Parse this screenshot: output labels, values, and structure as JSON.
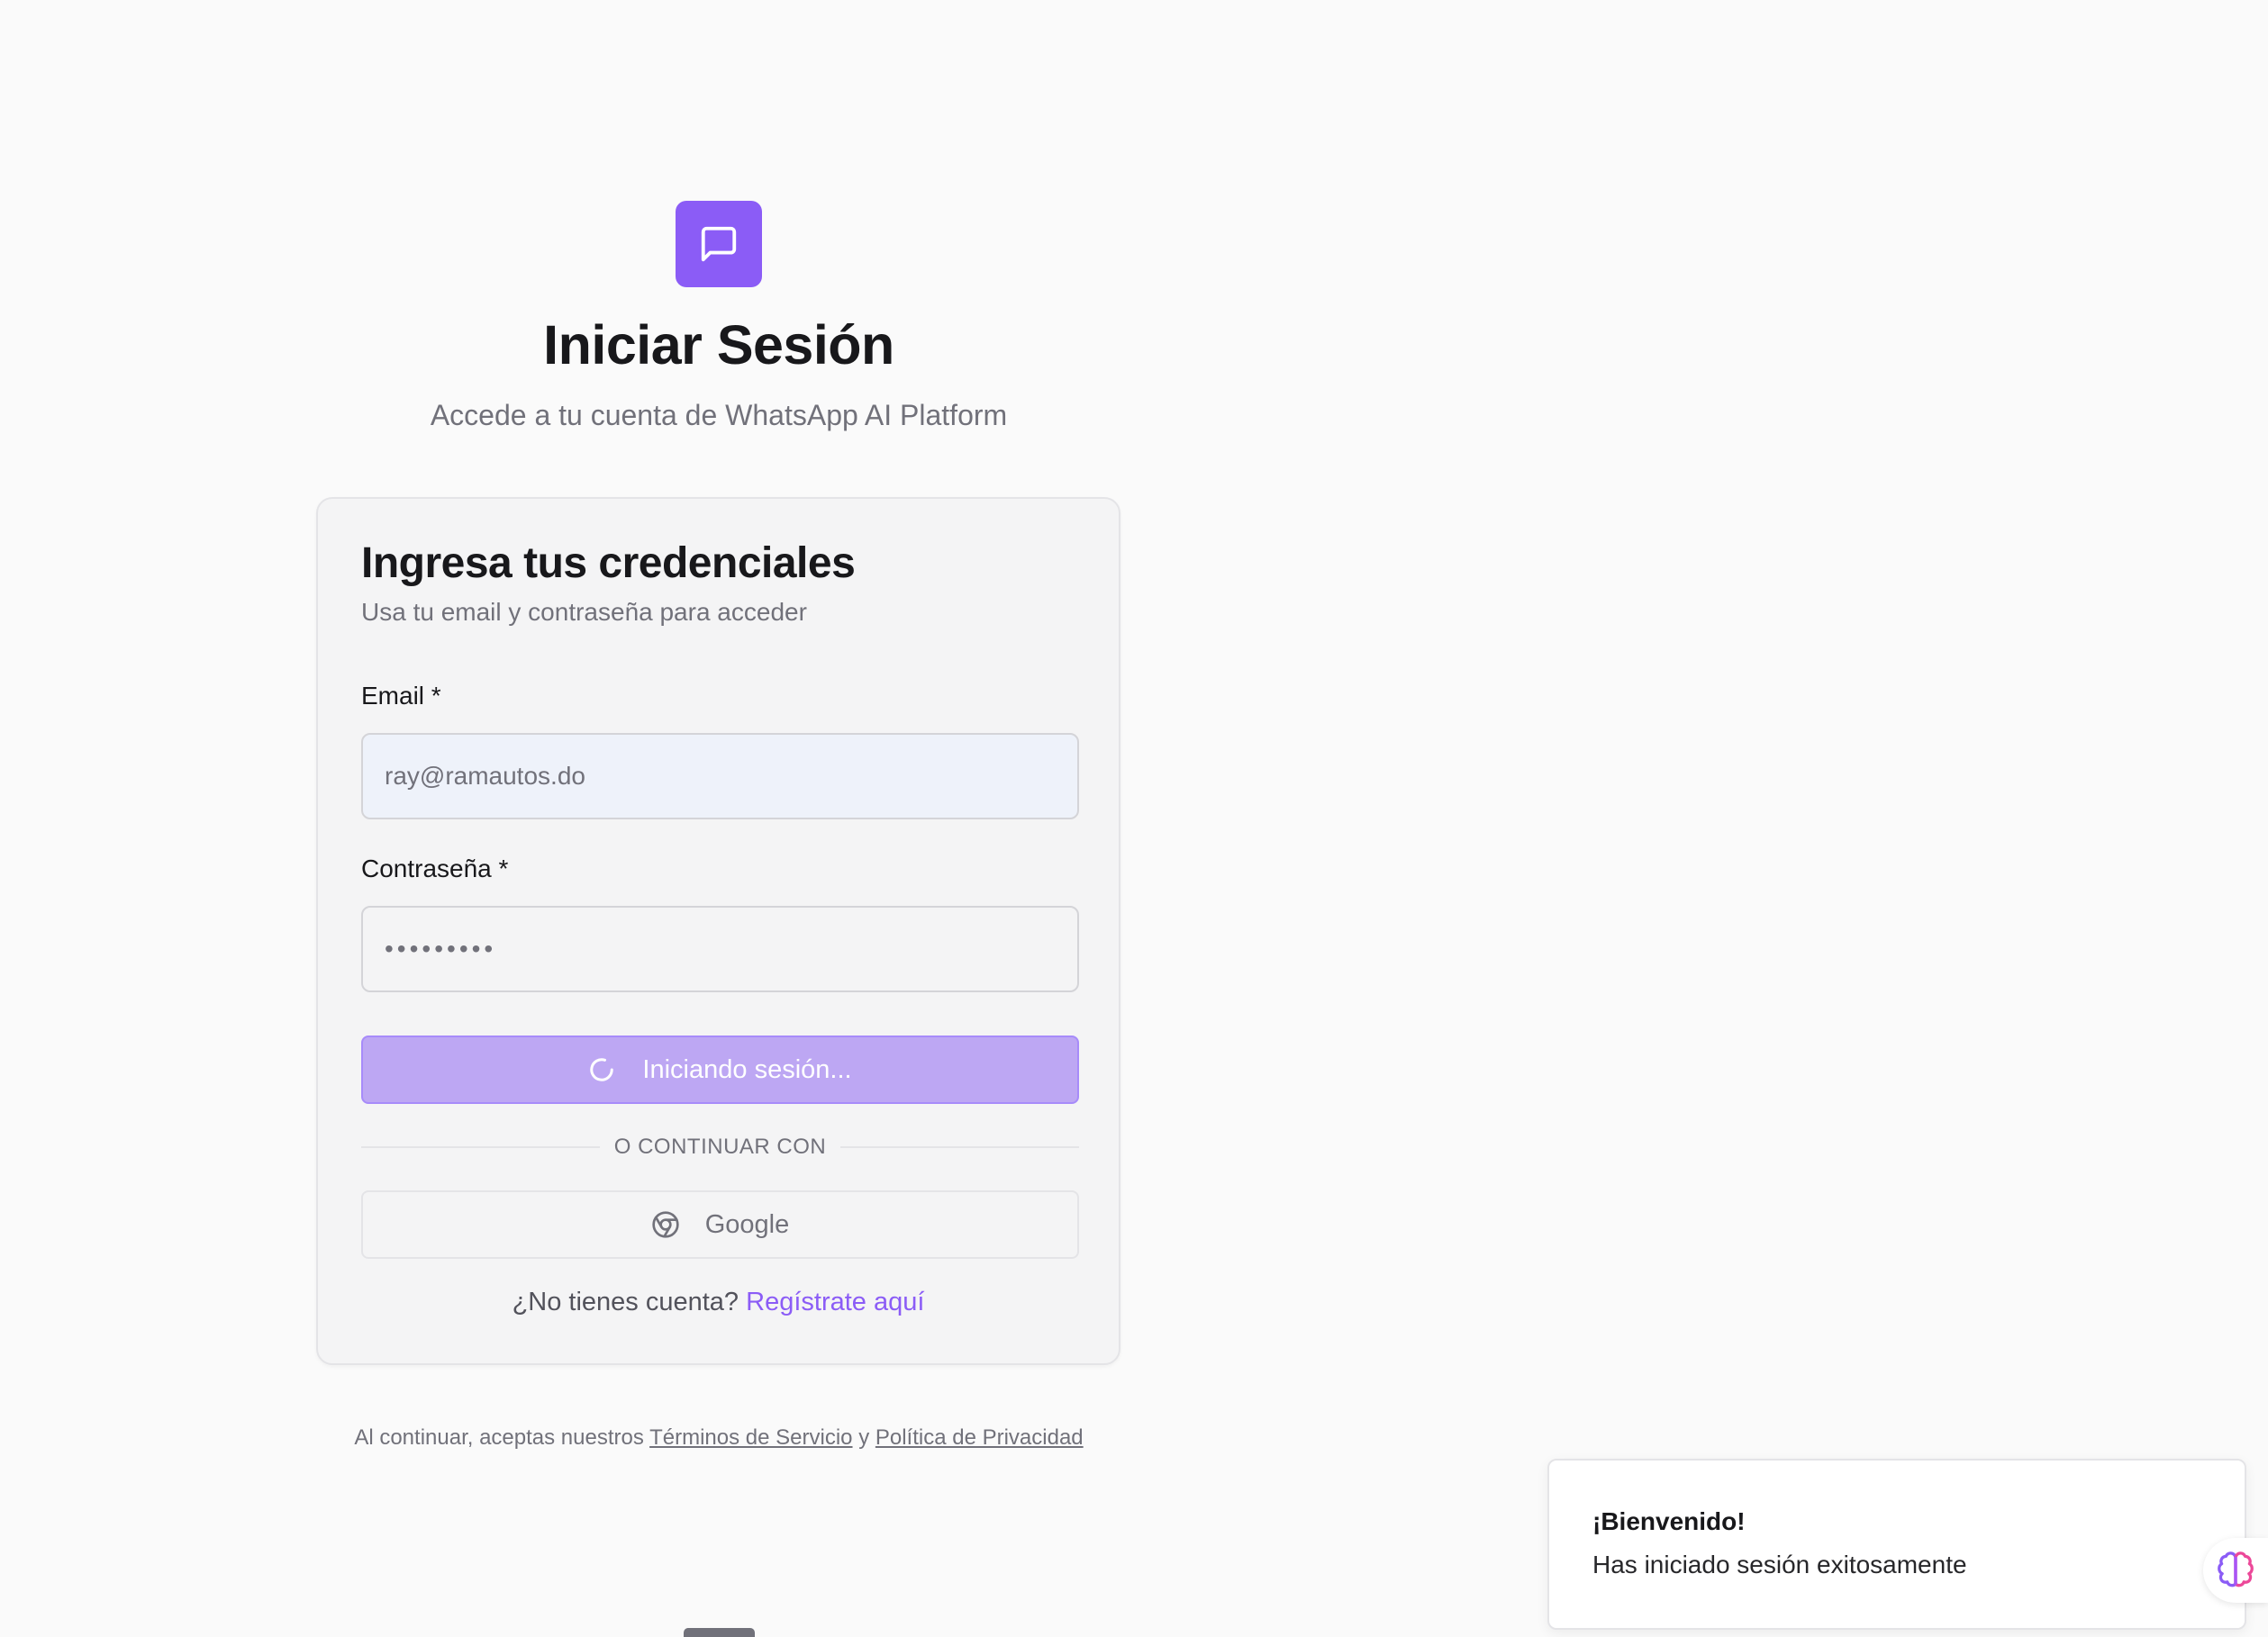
{
  "header": {
    "logo_icon": "message-square-icon",
    "title": "Iniciar Sesión",
    "subtitle": "Accede a tu cuenta de WhatsApp AI Platform"
  },
  "card": {
    "title": "Ingresa tus credenciales",
    "subtitle": "Usa tu email y contraseña para acceder"
  },
  "form": {
    "email_label": "Email *",
    "email_value": "ray@ramautos.do",
    "password_label": "Contraseña *",
    "password_value": "•••••••••",
    "submit_label": "Iniciando sesión...",
    "submit_icon": "loader-spinner-icon"
  },
  "divider": {
    "text": "O CONTINUAR CON"
  },
  "google": {
    "label": "Google",
    "icon": "chrome-icon"
  },
  "signup": {
    "prompt": "¿No tienes cuenta?",
    "link_label": "Regístrate aquí"
  },
  "legal": {
    "prefix": "Al continuar, aceptas nuestros",
    "terms_label": "Términos de Servicio",
    "connector": "y",
    "privacy_label": "Política de Privacidad"
  },
  "toast": {
    "title": "¡Bienvenido!",
    "message": "Has iniciado sesión exitosamente"
  },
  "assistant": {
    "icon": "brain-icon"
  },
  "colors": {
    "brand": "#8b5cf6",
    "button_loading": "#bda7f3",
    "background": "#fafafa",
    "card_background": "#f4f4f5",
    "autofill_background": "#eef2fa"
  }
}
